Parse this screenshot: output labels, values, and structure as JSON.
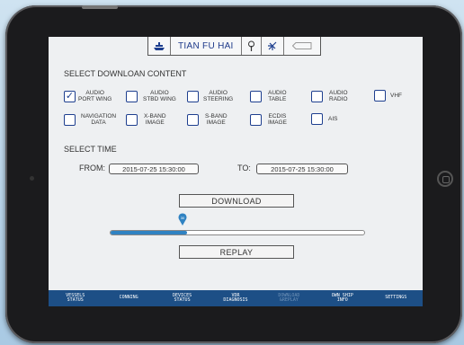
{
  "topbar": {
    "ship_name": "TIAN FU HAI",
    "icons": [
      "ship-icon",
      "antenna-icon",
      "satellite-icon",
      "battery-icon"
    ]
  },
  "content": {
    "title": "SELECT DOWNLOAN CONTENT",
    "options": [
      {
        "label_line1": "AUDIO",
        "label_line2": "PORT WING",
        "checked": true
      },
      {
        "label_line1": "AUDIO",
        "label_line2": "STBD WING",
        "checked": false
      },
      {
        "label_line1": "AUDIO",
        "label_line2": "STEERING",
        "checked": false
      },
      {
        "label_line1": "AUDIO",
        "label_line2": "TABLE",
        "checked": false
      },
      {
        "label_line1": "AUDIO",
        "label_line2": "RADIO",
        "checked": false
      },
      {
        "label_line1": "VHF",
        "label_line2": "",
        "checked": false
      },
      {
        "label_line1": "NAVIGATION",
        "label_line2": "DATA",
        "checked": false
      },
      {
        "label_line1": "X-BAND",
        "label_line2": "IMAGE",
        "checked": false
      },
      {
        "label_line1": "S-BAND",
        "label_line2": "IMAGE",
        "checked": false
      },
      {
        "label_line1": "ECDIS",
        "label_line2": "IMAGE",
        "checked": false
      },
      {
        "label_line1": "AIS",
        "label_line2": "",
        "checked": false
      }
    ],
    "check_mark": "✓"
  },
  "time": {
    "title": "SELECT TIME",
    "from_label": "FROM:",
    "from_value": "2015-07-25  15:30:00",
    "to_label": "TO:",
    "to_value": "2015-07-25  15:30:00"
  },
  "download": {
    "label": "DOWNLOAD"
  },
  "progress": {
    "percent": 30,
    "value_label": "30",
    "color": "#2f82c2"
  },
  "replay": {
    "label": "REPLAY"
  },
  "tabs": [
    {
      "line1": "VESSELS",
      "line2": "STATUS",
      "active": false
    },
    {
      "line1": "CONNING",
      "line2": "",
      "active": false
    },
    {
      "line1": "DEVICES",
      "line2": "STATUS",
      "active": false
    },
    {
      "line1": "VDR",
      "line2": "DIAGNOSIS",
      "active": false
    },
    {
      "line1": "DOWNLOAD",
      "line2": "&REPLAY",
      "active": true
    },
    {
      "line1": "OWN SHIP",
      "line2": "INFO",
      "active": false
    },
    {
      "line1": "SETTINGS",
      "line2": "",
      "active": false
    }
  ],
  "colors": {
    "accent": "#1d4f86",
    "checkbox": "#1e3f8f"
  }
}
